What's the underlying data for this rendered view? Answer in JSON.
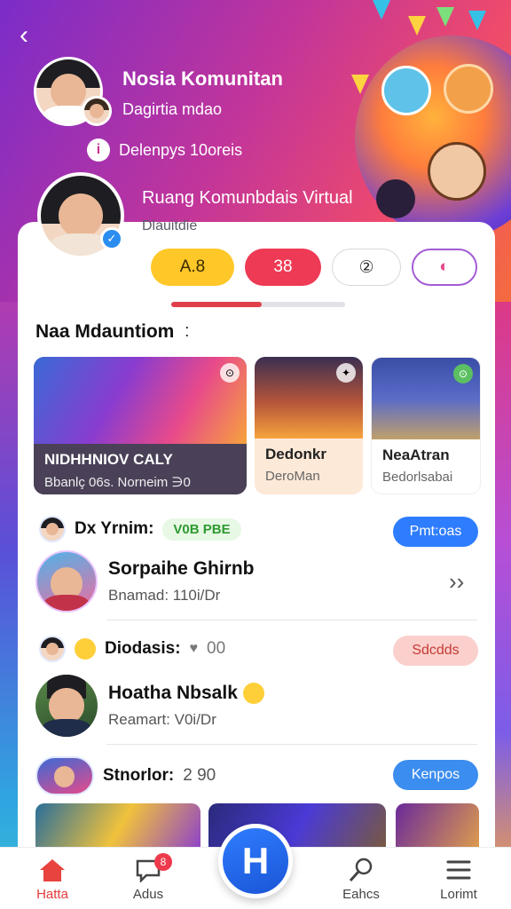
{
  "header": {
    "back_label": "‹",
    "title": "Nosia Komunitan",
    "subtitle": "Dagirtia mdao",
    "info_icon": "i",
    "info_text": "Delenpys 10oreis",
    "room_title": "Ruang Komunbdais Virtual",
    "room_subtitle": "Dlauitdie"
  },
  "pills": [
    "A.8",
    "38",
    "②",
    "◐"
  ],
  "progress": 0.52,
  "section": {
    "title": "Naa Mdauntiom",
    "marker": ":"
  },
  "tiles": [
    {
      "title": "NIDHHNIOV CALY",
      "subtitle": "Bbanlç 06s. Norneim ∋0",
      "badge": "⊙"
    },
    {
      "title": "Dedonkr",
      "subtitle": "DeroMan",
      "badge": "✦"
    },
    {
      "title": "NeaAtran",
      "subtitle": "Bedorlsabai",
      "badge": "⊙"
    }
  ],
  "groups": [
    {
      "head_label": "Dx Yrnim:",
      "tag": "V0B PBE",
      "action": "Pmt:oas",
      "user_name": "Sorpaihe Ghirnb",
      "user_sub": "Bnamad: 110i/Dr",
      "chevron": "››"
    },
    {
      "head_label": "Diodasis:",
      "count_icon": "♥",
      "count": "00",
      "action": "Sdcdds",
      "user_name": "Hoatha Nbsalk",
      "user_sub": "Reamart: V0i/Dr"
    },
    {
      "head_label": "Stnorlor:",
      "count": "2 90",
      "action": "Kenpos"
    }
  ],
  "nav": {
    "items": [
      {
        "label": "Hatta",
        "active": true
      },
      {
        "label": "Adus",
        "badge": "8"
      },
      {
        "label": "Eahcs"
      },
      {
        "label": "Lorimt"
      }
    ],
    "fab_label": "H"
  },
  "colors": {
    "accent_blue": "#2f7dff",
    "accent_red": "#ee3a55",
    "accent_yellow": "#ffc728",
    "hero_gradient_start": "#7b2cc9",
    "hero_gradient_end": "#f46b3f"
  }
}
